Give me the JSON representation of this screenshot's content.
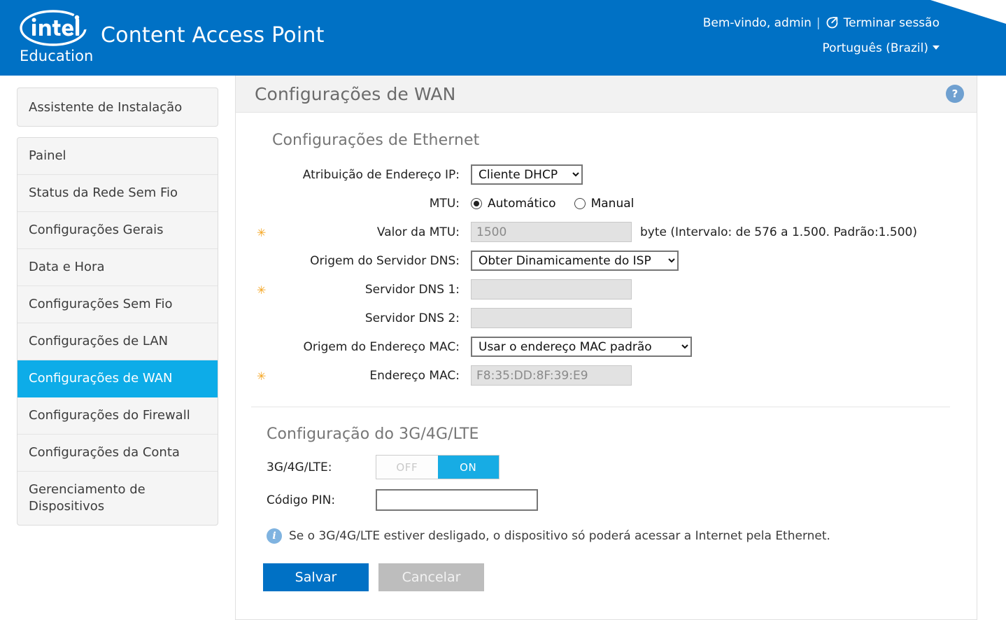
{
  "header": {
    "logo_name": "intel",
    "logo_sub": "Education",
    "app_title": "Content Access Point",
    "welcome": "Bem-vindo, admin",
    "separator": "|",
    "logout_label": "Terminar sessão",
    "logout_icon": "logout-arrow-icon",
    "language": "Português (Brazil)"
  },
  "sidebar": {
    "wizard": {
      "label": "Assistente de Instalação"
    },
    "items": [
      {
        "label": "Painel",
        "active": false
      },
      {
        "label": "Status da Rede Sem Fio",
        "active": false
      },
      {
        "label": "Configurações Gerais",
        "active": false
      },
      {
        "label": "Data e Hora",
        "active": false
      },
      {
        "label": "Configurações Sem Fio",
        "active": false
      },
      {
        "label": "Configurações de LAN",
        "active": false
      },
      {
        "label": "Configurações de WAN",
        "active": true
      },
      {
        "label": "Configurações do Firewall",
        "active": false
      },
      {
        "label": "Configurações da Conta",
        "active": false
      },
      {
        "label": "Gerenciamento de Dispositivos",
        "active": false
      }
    ]
  },
  "content": {
    "title": "Configurações de WAN",
    "help_icon": "?",
    "ethernet": {
      "section_title": "Configurações de Ethernet",
      "ip_assignment": {
        "label": "Atribuição de Endereço IP:",
        "value": "Cliente DHCP",
        "options": [
          "Cliente DHCP"
        ]
      },
      "mtu": {
        "label": "MTU:",
        "option_auto": "Automático",
        "option_manual": "Manual",
        "selected": "Automático"
      },
      "mtu_value": {
        "label": "Valor da MTU:",
        "value": "1500",
        "note": "byte (Intervalo: de 576 a 1.500. Padrão:1.500)",
        "required": true,
        "disabled": true
      },
      "dns_source": {
        "label": "Origem do Servidor DNS:",
        "value": "Obter Dinamicamente do ISP",
        "options": [
          "Obter Dinamicamente do ISP"
        ]
      },
      "dns1": {
        "label": "Servidor DNS 1:",
        "value": "",
        "required": true,
        "disabled": true
      },
      "dns2": {
        "label": "Servidor DNS 2:",
        "value": "",
        "required": false,
        "disabled": true
      },
      "mac_source": {
        "label": "Origem do Endereço MAC:",
        "value": "Usar o endereço MAC padrão",
        "options": [
          "Usar o endereço MAC padrão"
        ]
      },
      "mac_address": {
        "label": "Endereço MAC:",
        "value": "F8:35:DD:8F:39:E9",
        "required": true,
        "disabled": true
      }
    },
    "lte": {
      "section_title": "Configuração do 3G/4G/LTE",
      "toggle": {
        "label": "3G/4G/LTE:",
        "off_label": "OFF",
        "on_label": "ON",
        "state": "ON"
      },
      "pin": {
        "label": "Código PIN:",
        "value": "",
        "placeholder": ""
      },
      "info_icon": "i",
      "info_text": "Se o 3G/4G/LTE estiver desligado, o dispositivo só poderá acessar a Internet pela Ethernet."
    },
    "buttons": {
      "save": "Salvar",
      "cancel": "Cancelar"
    }
  },
  "colors": {
    "header_blue": "#0071c5",
    "accent_cyan": "#0dace8",
    "required_star": "#f5a623",
    "save_blue": "#0071c5",
    "cancel_gray": "#bdbdbd"
  }
}
